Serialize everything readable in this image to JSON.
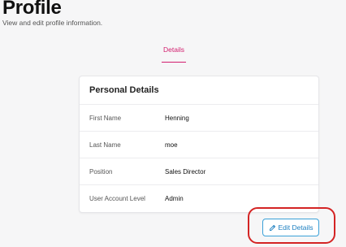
{
  "header": {
    "title": "Profile",
    "subtitle": "View and edit profile information."
  },
  "tabs": [
    {
      "label": "Details",
      "active": true
    }
  ],
  "card": {
    "title": "Personal Details",
    "rows": [
      {
        "label": "First Name",
        "value": "Henning"
      },
      {
        "label": "Last Name",
        "value": "moe"
      },
      {
        "label": "Position",
        "value": "Sales Director"
      },
      {
        "label": "User Account Level",
        "value": "Admin"
      }
    ]
  },
  "actions": {
    "edit_label": "Edit Details",
    "edit_icon": "pencil-icon"
  },
  "colors": {
    "accent": "#d21f6e",
    "button": "#1c7fc0",
    "highlight": "#d42424"
  }
}
